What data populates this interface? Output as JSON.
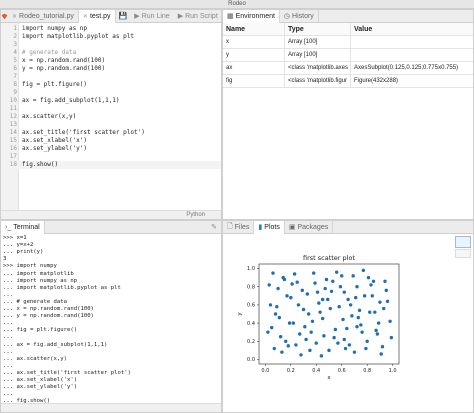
{
  "window": {
    "title": "Rodeo"
  },
  "editor": {
    "tabs": [
      {
        "label": "Rodeo_tutorial.py",
        "active": false
      },
      {
        "label": "test.py",
        "active": true
      }
    ],
    "run_line_label": "Run Line",
    "run_script_label": "Run Script",
    "lines": [
      {
        "n": "1",
        "text": "import numpy as np"
      },
      {
        "n": "2",
        "text": "import matplotlib.pyplot as plt"
      },
      {
        "n": "3",
        "text": ""
      },
      {
        "n": "4",
        "text": "# generate data"
      },
      {
        "n": "5",
        "text": "x = np.random.rand(100)"
      },
      {
        "n": "6",
        "text": "y = np.random.rand(100)"
      },
      {
        "n": "7",
        "text": ""
      },
      {
        "n": "8",
        "text": "fig = plt.figure()"
      },
      {
        "n": "9",
        "text": ""
      },
      {
        "n": "10",
        "text": "ax = fig.add_subplot(1,1,1)"
      },
      {
        "n": "11",
        "text": ""
      },
      {
        "n": "12",
        "text": "ax.scatter(x,y)"
      },
      {
        "n": "13",
        "text": ""
      },
      {
        "n": "14",
        "text": "ax.set_title('first scatter plot')"
      },
      {
        "n": "15",
        "text": "ax.set_xlabel('x')"
      },
      {
        "n": "16",
        "text": "ax.set_ylabel('y')"
      },
      {
        "n": "17",
        "text": ""
      },
      {
        "n": "18",
        "text": "fig.show()"
      }
    ],
    "language": "Python"
  },
  "environment": {
    "tabs": [
      {
        "label": "Environment",
        "active": true
      },
      {
        "label": "History",
        "active": false
      }
    ],
    "columns": [
      "Name",
      "Type",
      "Value"
    ],
    "rows": [
      [
        "x",
        "Array [100]",
        ""
      ],
      [
        "y",
        "Array [100]",
        ""
      ],
      [
        "ax",
        "<class 'matplotlib.axes",
        "AxesSubplot(0.125,0.125;0.775x0.755)"
      ],
      [
        "fig",
        "<class 'matplotlib.figur",
        "Figure(432x288)"
      ]
    ]
  },
  "terminal": {
    "tab_label": "Terminal",
    "lines": [
      ">>> x=1",
      "... y=x+2",
      "... print(y)",
      "3",
      ">>> import numpy",
      "... import matplotlib",
      "... import numpy as np",
      "... import matplotlib.pyplot as plt",
      "...",
      "... # generate data",
      "... x = np.random.rand(100)",
      "... y = np.random.rand(100)",
      "...",
      "... fig = plt.figure()",
      "...",
      "... ax = fig.add_subplot(1,1,1)",
      "...",
      "... ax.scatter(x,y)",
      "...",
      "... ax.set_title('first scatter plot')",
      "... ax.set_xlabel('x')",
      "... ax.set_ylabel('y')",
      "...",
      "... fig.show()"
    ]
  },
  "plots_panel": {
    "tabs": [
      {
        "label": "Files",
        "active": false
      },
      {
        "label": "Plots",
        "active": true
      },
      {
        "label": "Packages",
        "active": false
      }
    ]
  },
  "colors": {
    "accent": "#2f78b7",
    "marker": "#1f6fb4",
    "tab_bar": "#ececec"
  },
  "chart_data": {
    "type": "scatter",
    "title": "first scatter plot",
    "xlabel": "x",
    "ylabel": "y",
    "xlim": [
      -0.05,
      1.05
    ],
    "ylim": [
      -0.05,
      1.05
    ],
    "xticks": [
      "0.0",
      "0.2",
      "0.4",
      "0.6",
      "0.8",
      "1.0"
    ],
    "yticks": [
      "0.0",
      "0.2",
      "0.4",
      "0.6",
      "0.8",
      "1.0"
    ],
    "grid": false,
    "series": [
      {
        "x": [
          0.03,
          0.05,
          0.07,
          0.04,
          0.1,
          0.12,
          0.08,
          0.14,
          0.18,
          0.2,
          0.22,
          0.25,
          0.28,
          0.3,
          0.33,
          0.36,
          0.38,
          0.4,
          0.42,
          0.45,
          0.48,
          0.5,
          0.52,
          0.55,
          0.58,
          0.6,
          0.62,
          0.65,
          0.68,
          0.7,
          0.72,
          0.75,
          0.78,
          0.8,
          0.82,
          0.85,
          0.88,
          0.9,
          0.92,
          0.95,
          0.98,
          0.06,
          0.11,
          0.16,
          0.21,
          0.26,
          0.31,
          0.35,
          0.41,
          0.46,
          0.51,
          0.56,
          0.61,
          0.66,
          0.71,
          0.76,
          0.81,
          0.86,
          0.91,
          0.96,
          0.02,
          0.09,
          0.15,
          0.19,
          0.24,
          0.29,
          0.34,
          0.39,
          0.44,
          0.49,
          0.54,
          0.59,
          0.64,
          0.69,
          0.74,
          0.79,
          0.84,
          0.89,
          0.94,
          0.99,
          0.13,
          0.23,
          0.37,
          0.47,
          0.57,
          0.67,
          0.77,
          0.87,
          0.17,
          0.27,
          0.43,
          0.53,
          0.63,
          0.73,
          0.83,
          0.93,
          0.32,
          0.62,
          0.72,
          0.45
        ],
        "y": [
          0.82,
          0.35,
          0.12,
          0.6,
          0.78,
          0.25,
          0.5,
          0.9,
          0.15,
          0.68,
          0.4,
          0.85,
          0.05,
          0.55,
          0.72,
          0.3,
          0.95,
          0.18,
          0.62,
          0.45,
          0.88,
          0.1,
          0.75,
          0.33,
          0.58,
          0.92,
          0.22,
          0.66,
          0.48,
          0.08,
          0.8,
          0.38,
          0.7,
          0.2,
          0.52,
          0.86,
          0.28,
          0.63,
          0.14,
          0.76,
          0.42,
          0.95,
          0.46,
          0.2,
          0.83,
          0.6,
          0.36,
          0.1,
          0.74,
          0.26,
          0.56,
          0.96,
          0.44,
          0.16,
          0.68,
          0.3,
          0.9,
          0.52,
          0.06,
          0.64,
          0.3,
          0.58,
          0.88,
          0.4,
          0.16,
          0.76,
          0.5,
          0.84,
          0.04,
          0.66,
          0.24,
          0.8,
          0.34,
          0.92,
          0.54,
          0.12,
          0.7,
          0.4,
          0.86,
          0.24,
          0.08,
          0.94,
          0.42,
          0.78,
          0.18,
          0.6,
          0.98,
          0.32,
          0.7,
          0.28,
          0.52,
          0.86,
          0.12,
          0.46,
          0.82,
          0.56,
          0.22,
          0.74,
          0.36,
          0.66
        ]
      }
    ]
  }
}
